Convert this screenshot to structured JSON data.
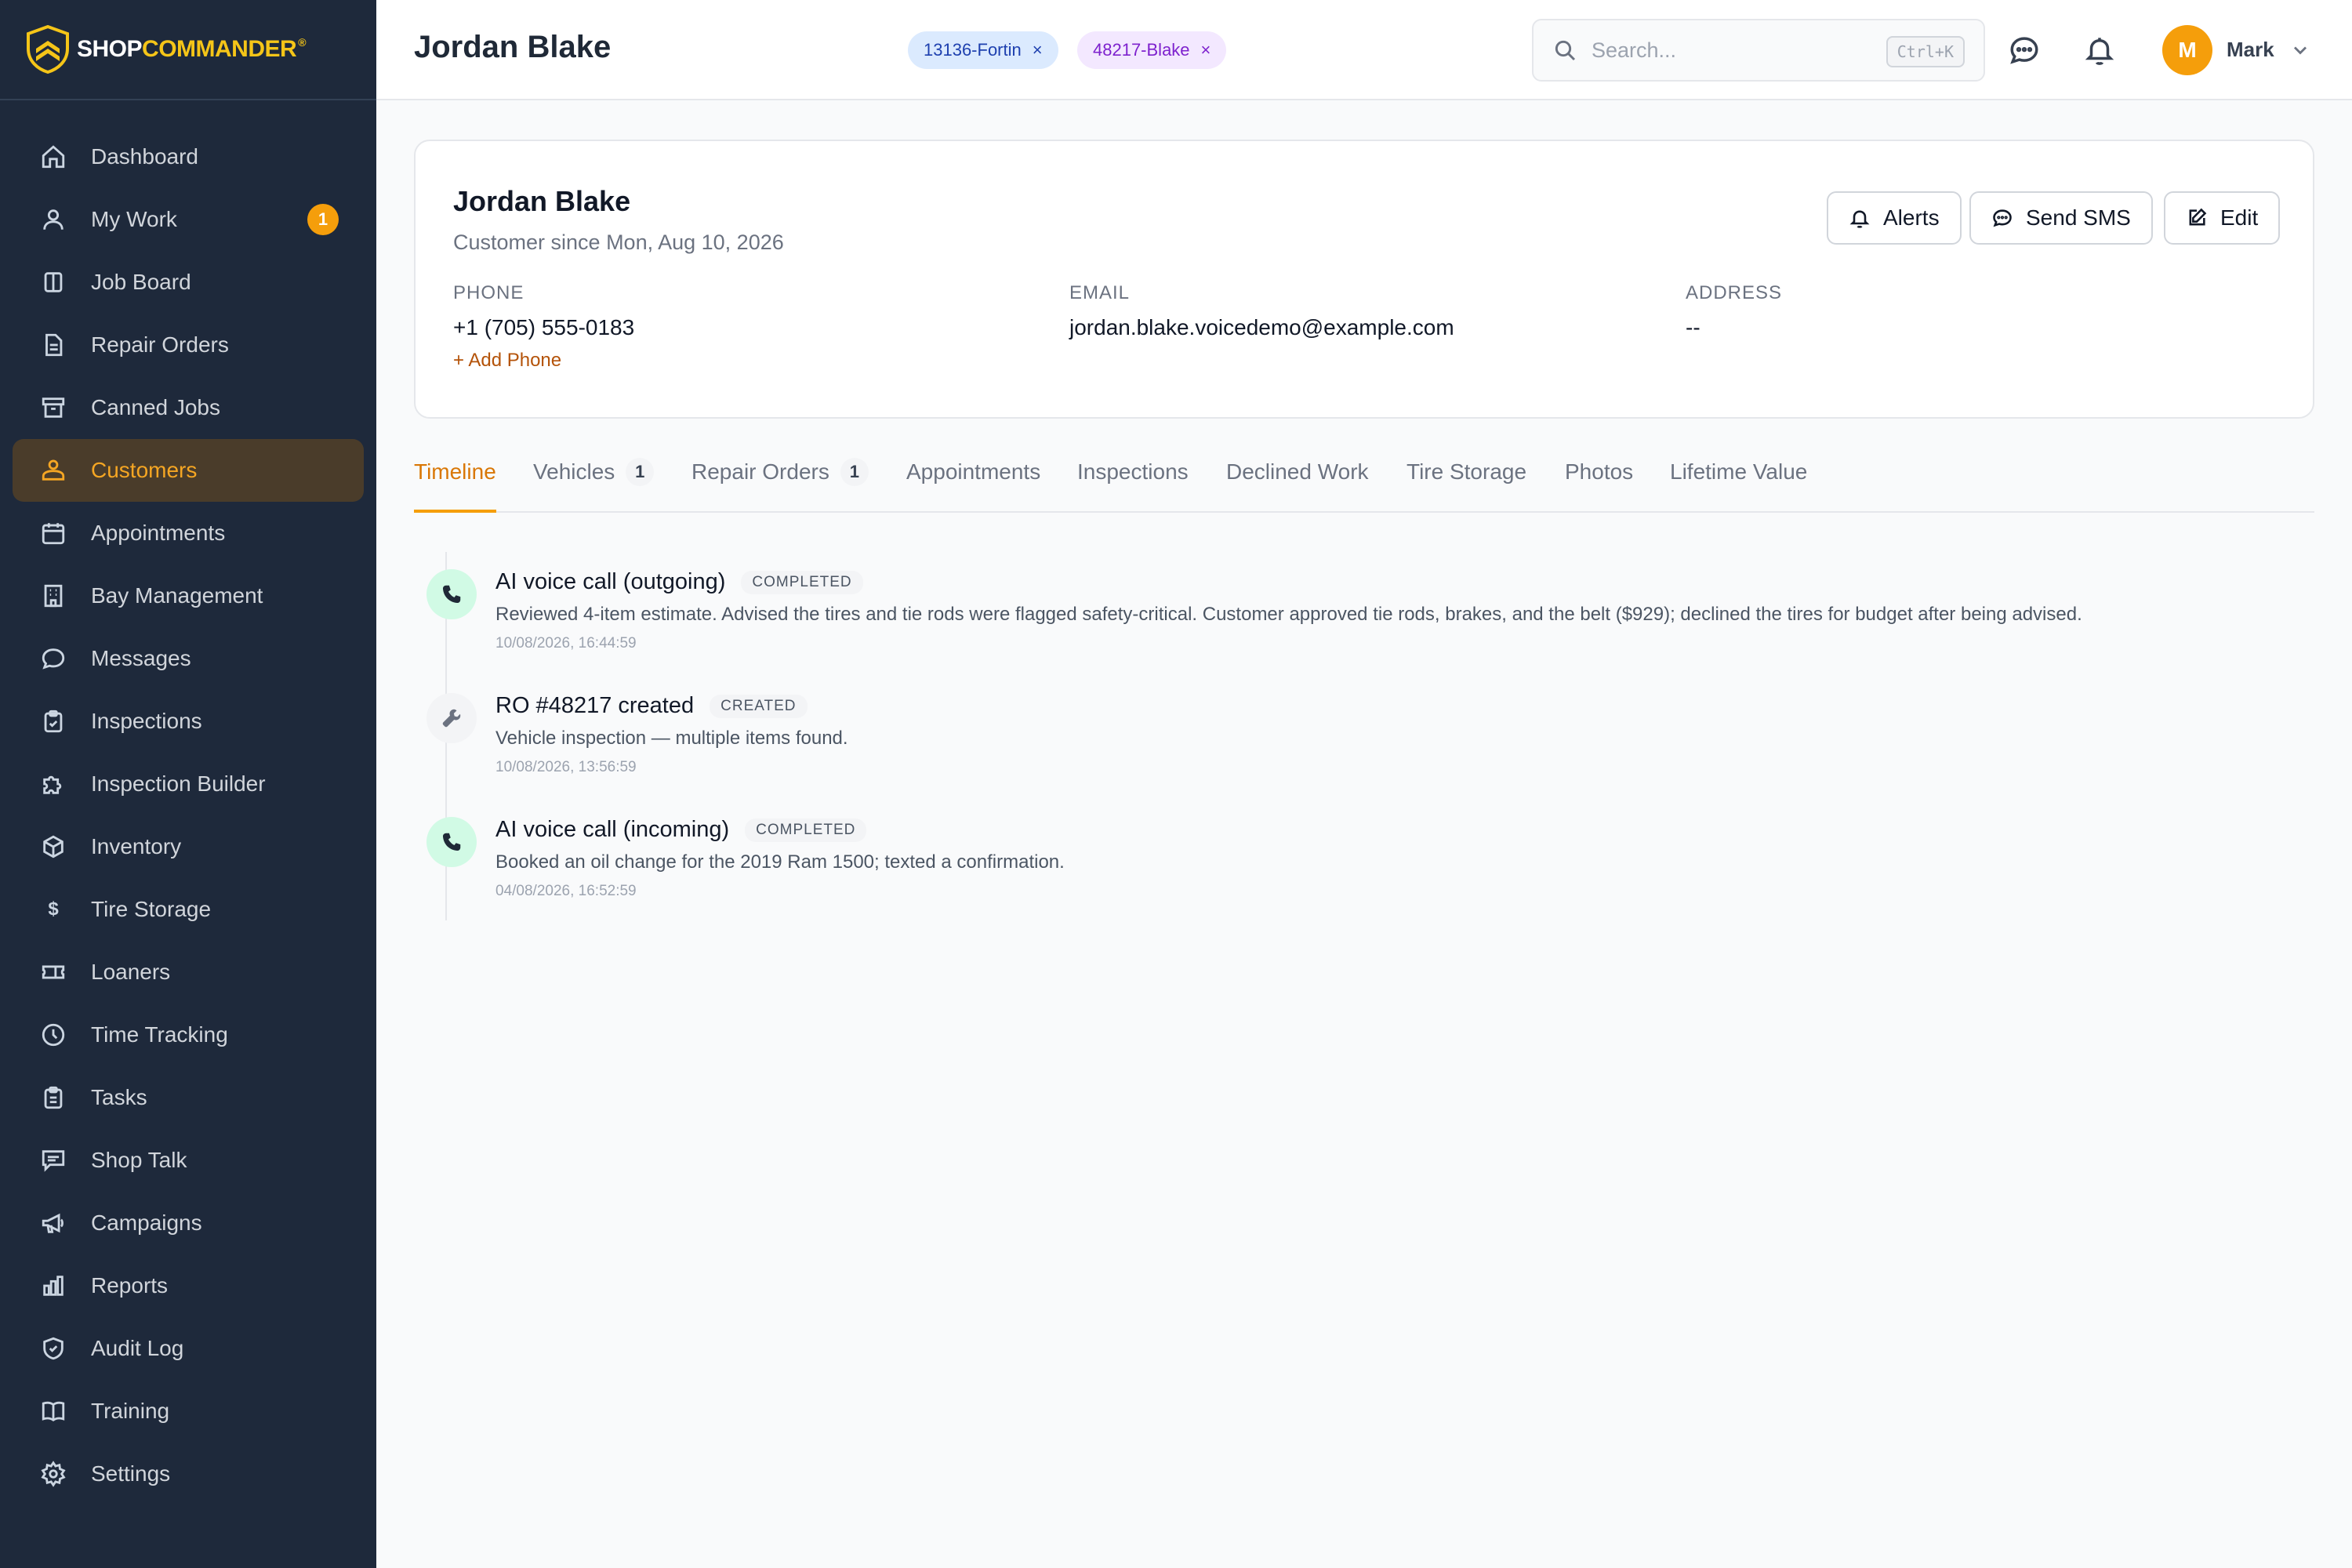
{
  "brand": {
    "shop": "SHOP",
    "commander": "COMMANDER",
    "reg": "®"
  },
  "sidebar": {
    "items": [
      {
        "label": "Dashboard",
        "icon": "home-icon"
      },
      {
        "label": "My Work",
        "icon": "user-icon",
        "badge": "1"
      },
      {
        "label": "Job Board",
        "icon": "columns-icon"
      },
      {
        "label": "Repair Orders",
        "icon": "document-icon"
      },
      {
        "label": "Canned Jobs",
        "icon": "archive-icon"
      },
      {
        "label": "Customers",
        "icon": "users-icon",
        "active": true
      },
      {
        "label": "Appointments",
        "icon": "calendar-icon"
      },
      {
        "label": "Bay Management",
        "icon": "building-icon"
      },
      {
        "label": "Messages",
        "icon": "chat-icon"
      },
      {
        "label": "Inspections",
        "icon": "clipboard-check-icon"
      },
      {
        "label": "Inspection Builder",
        "icon": "puzzle-icon"
      },
      {
        "label": "Inventory",
        "icon": "box-icon"
      },
      {
        "label": "Tire Storage",
        "icon": "dollar-icon"
      },
      {
        "label": "Loaners",
        "icon": "ticket-icon"
      },
      {
        "label": "Time Tracking",
        "icon": "clock-icon"
      },
      {
        "label": "Tasks",
        "icon": "clipboard-list-icon"
      },
      {
        "label": "Shop Talk",
        "icon": "message-square-icon"
      },
      {
        "label": "Campaigns",
        "icon": "megaphone-icon"
      },
      {
        "label": "Reports",
        "icon": "bar-chart-icon"
      },
      {
        "label": "Audit Log",
        "icon": "shield-check-icon"
      },
      {
        "label": "Training",
        "icon": "book-icon"
      },
      {
        "label": "Settings",
        "icon": "gear-icon"
      }
    ]
  },
  "header": {
    "title": "Jordan Blake",
    "chips": [
      {
        "label": "13136-Fortin",
        "close": "×"
      },
      {
        "label": "48217-Blake",
        "close": "×"
      }
    ],
    "search": {
      "placeholder": "Search...",
      "shortcut": "Ctrl+K"
    },
    "user": {
      "initial": "M",
      "name": "Mark"
    }
  },
  "customer": {
    "name": "Jordan Blake",
    "since": "Customer since Mon, Aug 10, 2026",
    "phone_label": "PHONE",
    "phone": "+1 (705) 555-0183",
    "add_phone": "+ Add Phone",
    "email_label": "EMAIL",
    "email": "jordan.blake.voicedemo@example.com",
    "address_label": "ADDRESS",
    "address": "--",
    "buttons": {
      "alerts": "Alerts",
      "sms": "Send SMS",
      "edit": "Edit"
    }
  },
  "tabs": [
    {
      "label": "Timeline",
      "active": true
    },
    {
      "label": "Vehicles",
      "count": "1"
    },
    {
      "label": "Repair Orders",
      "count": "1"
    },
    {
      "label": "Appointments"
    },
    {
      "label": "Inspections"
    },
    {
      "label": "Declined Work"
    },
    {
      "label": "Tire Storage"
    },
    {
      "label": "Photos"
    },
    {
      "label": "Lifetime Value"
    }
  ],
  "timeline": [
    {
      "title": "AI voice call (outgoing)",
      "status": "COMPLETED",
      "icon": "phone-icon",
      "description": "Reviewed 4-item estimate. Advised the tires and tie rods were flagged safety-critical. Customer approved tie rods, brakes, and the belt ($929); declined the tires for budget after being advised.",
      "time": "10/08/2026, 16:44:59"
    },
    {
      "title": "RO #48217 created",
      "status": "CREATED",
      "icon": "wrench-icon",
      "description": "Vehicle inspection — multiple items found.",
      "time": "10/08/2026, 13:56:59"
    },
    {
      "title": "AI voice call (incoming)",
      "status": "COMPLETED",
      "icon": "phone-icon",
      "description": "Booked an oil change for the 2019 Ram 1500; texted a confirmation.",
      "time": "04/08/2026, 16:52:59"
    }
  ],
  "colors": {
    "sidebar_bg": "#1e293b",
    "accent": "#f59e0b",
    "active_nav_bg": "#4a3c2a",
    "chip_blue": "#dbeafe",
    "chip_purple": "#f3e8ff"
  }
}
